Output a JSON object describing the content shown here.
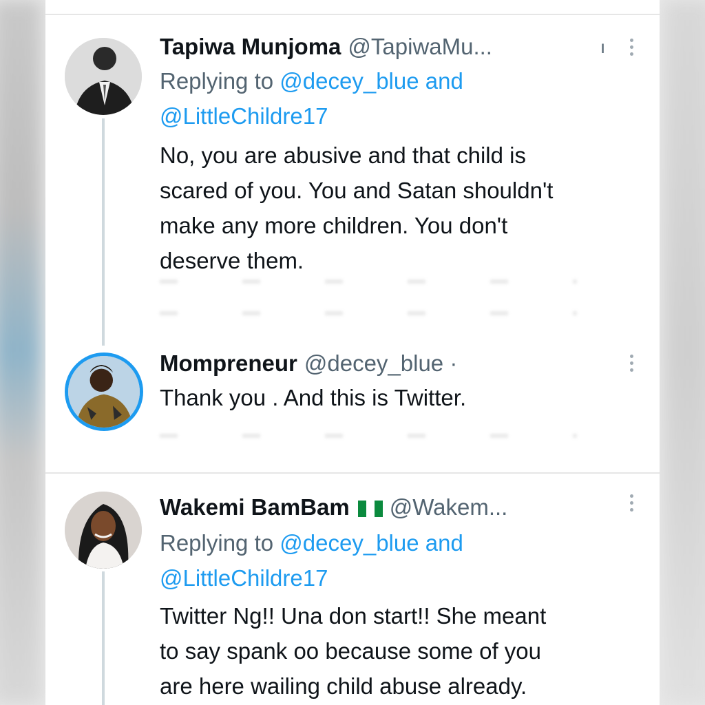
{
  "tweets": [
    {
      "name": "Tapiwa Munjoma",
      "handle": "@TapiwaMu...",
      "meta_fragment": "ı",
      "replying_prefix": "Replying to",
      "replying_mention1": "@decey_blue",
      "replying_and": "and",
      "replying_mention2": "@LittleChildre17",
      "body_lines": [
        "No, you are abusive and that child is",
        "scared of you. You and Satan shouldn't",
        "make any more children. You don't",
        "deserve them."
      ]
    },
    {
      "name": "Mompreneur",
      "handle": "@decey_blue ·",
      "body_lines": [
        "Thank you . And this is Twitter."
      ]
    },
    {
      "name": "Wakemi BamBam",
      "handle": "@Wakem...",
      "replying_prefix": "Replying to",
      "replying_mention1": "@decey_blue",
      "replying_and": "and",
      "replying_mention2": "@LittleChildre17",
      "body_lines": [
        "Twitter Ng!! Una don start!! She meant",
        "to say spank oo because some of you",
        "are here wailing child abuse already."
      ]
    }
  ],
  "colors": {
    "link": "#1d9bf0",
    "secondary_text": "#536471",
    "primary_text": "#0f1419",
    "mompreneur_avatar_ring": "#1d9bf0",
    "flag_green": "#0b8a3e",
    "flag_white": "#ffffff"
  },
  "icons": {
    "more": "more-options-icon",
    "flag": "nigeria-flag-icon"
  }
}
